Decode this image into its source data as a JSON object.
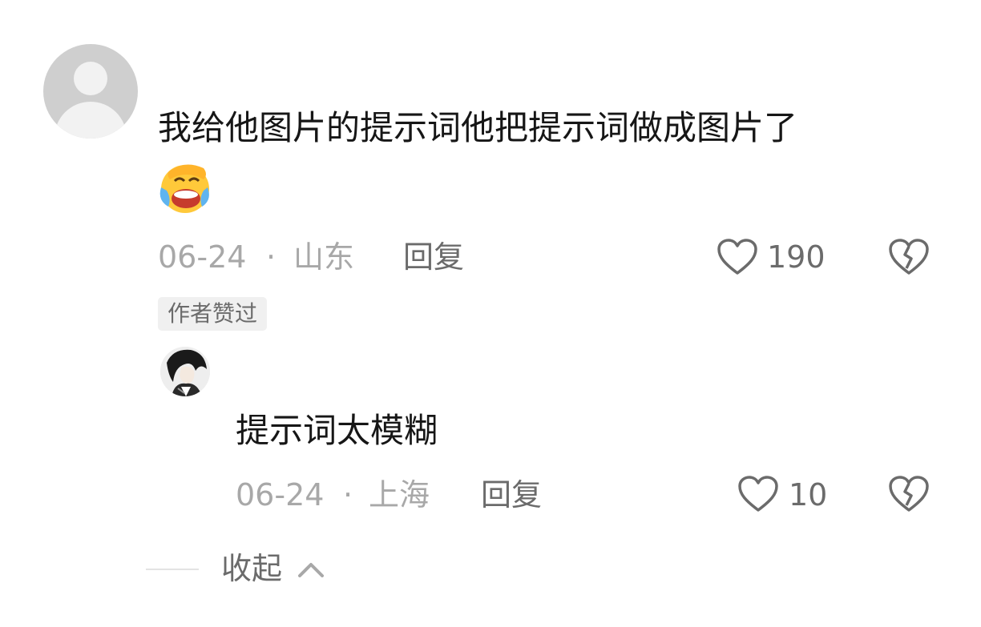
{
  "comment": {
    "text": "我给他图片的提示词他把提示词做成图片了",
    "emoji": "laughing-crying-emoji",
    "date": "06-24",
    "separator": "·",
    "location": "山东",
    "reply_label": "回复",
    "likes": "190",
    "author_badge": "作者赞过"
  },
  "reply": {
    "text": "提示词太模糊",
    "date": "06-24",
    "separator": "·",
    "location": "上海",
    "reply_label": "回复",
    "likes": "10"
  },
  "collapse_label": "收起",
  "colors": {
    "text_primary": "#161616",
    "text_meta": "#a8a8a8",
    "text_secondary": "#6b6b6b",
    "badge_bg": "#f0f0f0"
  }
}
